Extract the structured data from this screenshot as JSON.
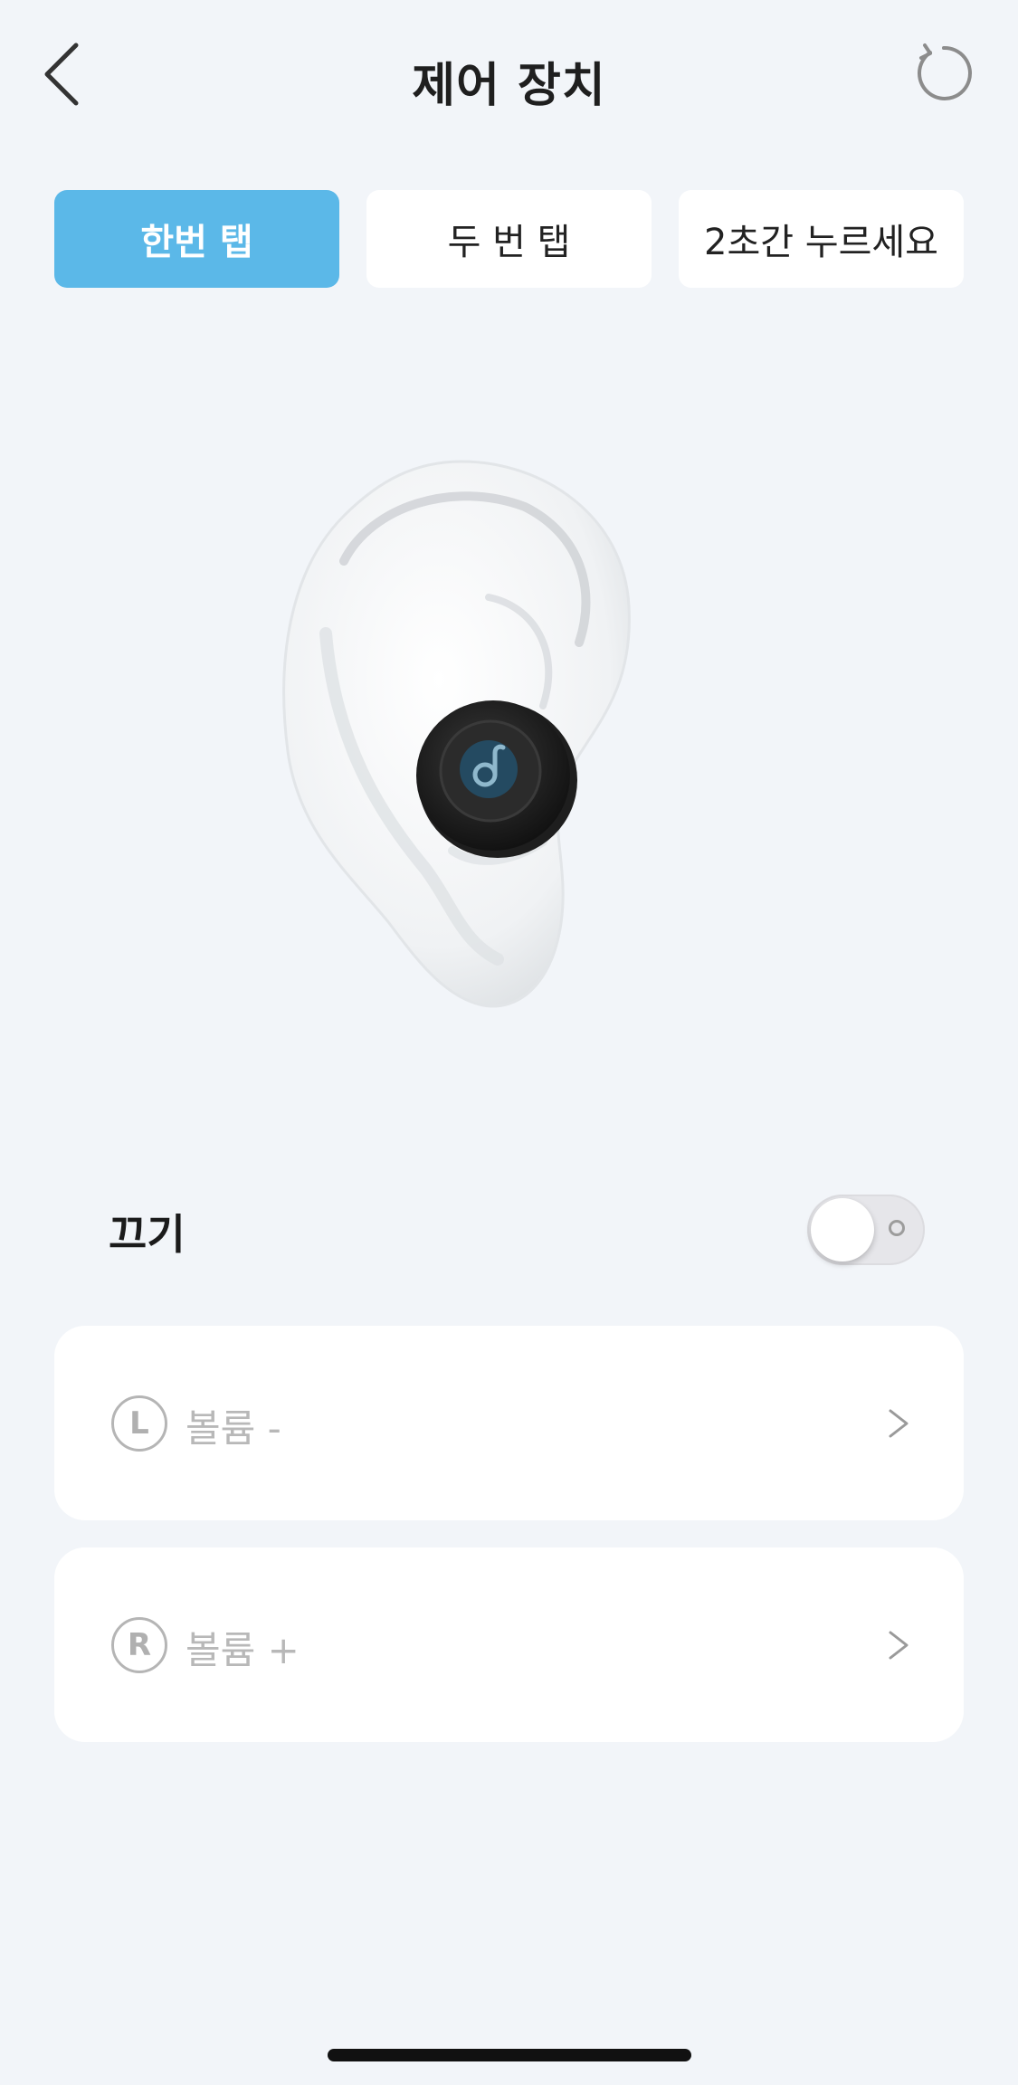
{
  "header": {
    "title": "제어 장치",
    "back_icon": "chevron-left-icon",
    "reset_icon": "reset-icon"
  },
  "tabs": [
    {
      "label": "한번 탭",
      "active": true
    },
    {
      "label": "두 번 탭",
      "active": false
    },
    {
      "label": "2초간 누르세요",
      "active": false
    }
  ],
  "toggle": {
    "label": "끄기",
    "state": "off"
  },
  "actions": [
    {
      "side": "L",
      "label": "볼륨 -",
      "icon": "chevron-right-icon"
    },
    {
      "side": "R",
      "label": "볼륨 +",
      "icon": "chevron-right-icon"
    }
  ],
  "colors": {
    "background": "#f2f5f9",
    "accent": "#5bb8e8",
    "card": "#ffffff",
    "disabled_text": "#b8b8b8"
  }
}
